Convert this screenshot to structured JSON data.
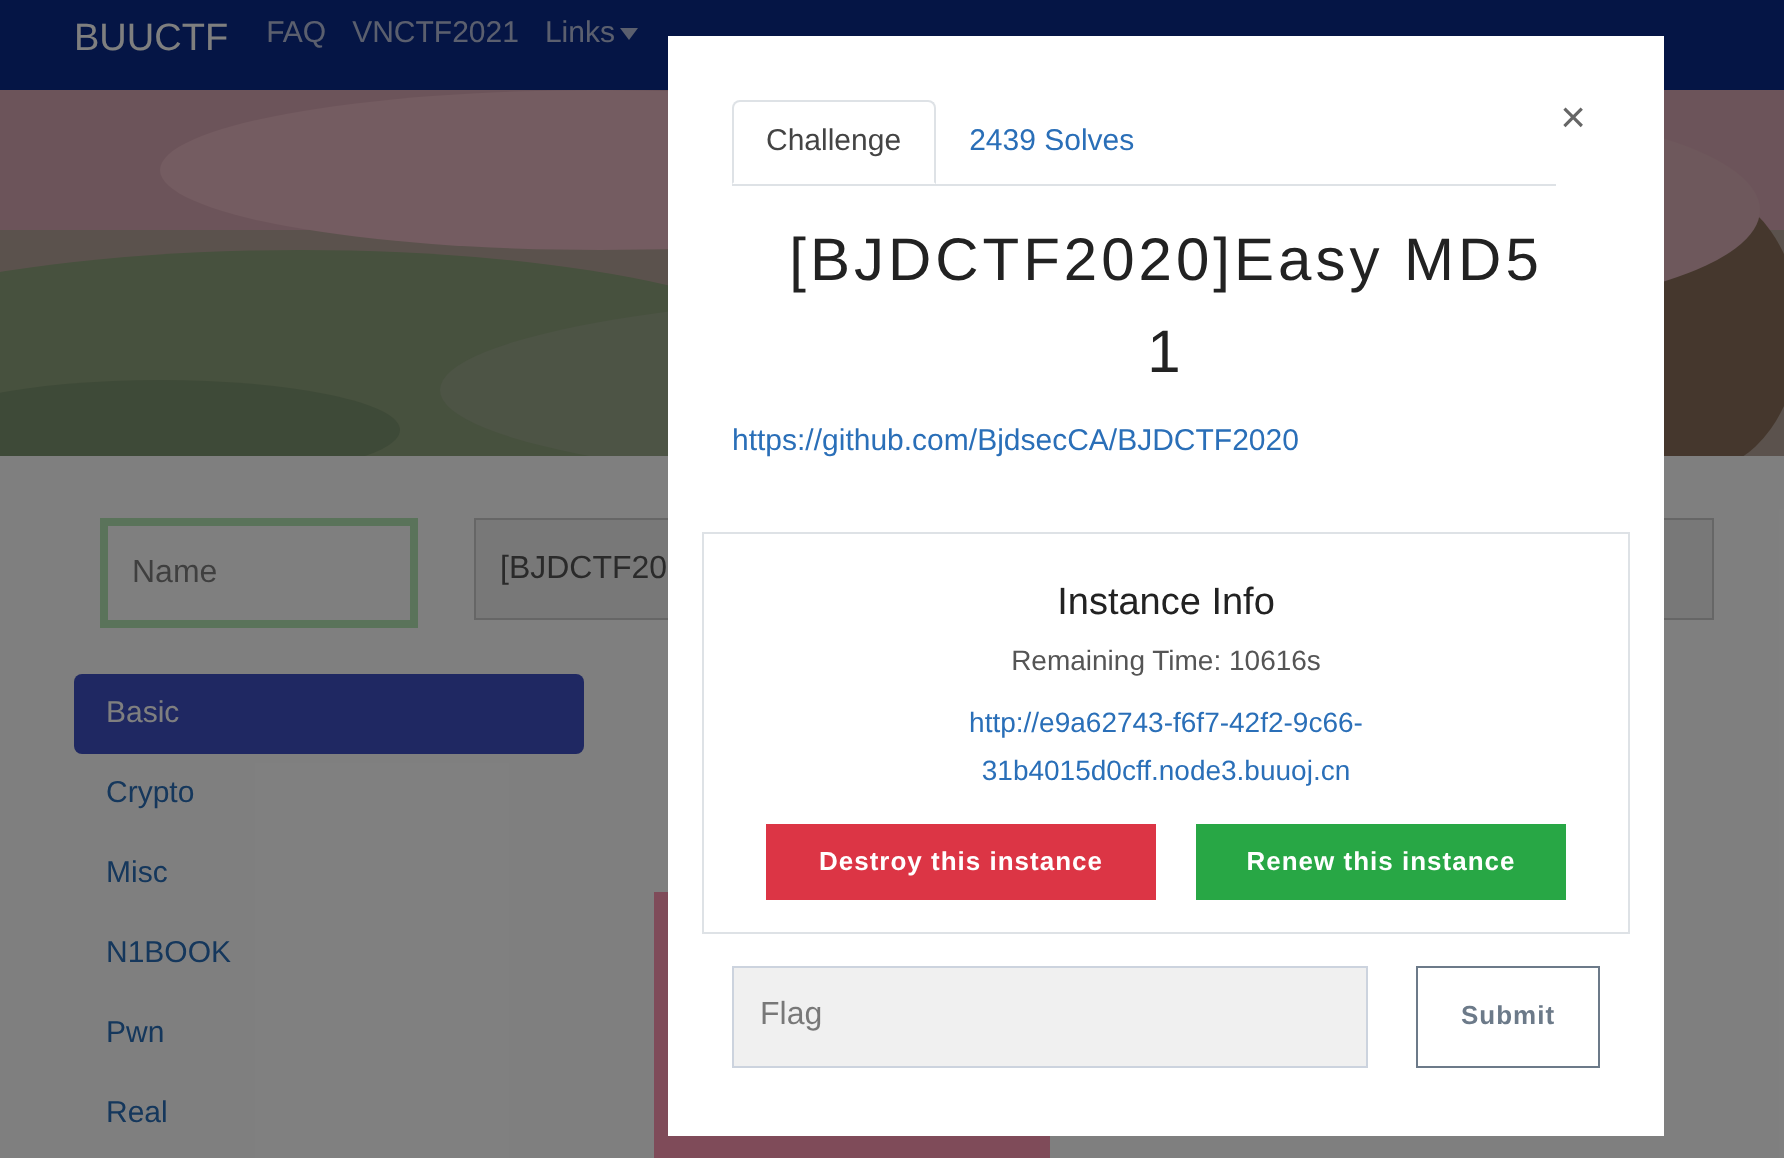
{
  "navbar": {
    "brand": "BUUCTF",
    "items": [
      {
        "label": "FAQ",
        "dropdown": false
      },
      {
        "label": "VNCTF2021",
        "dropdown": false
      },
      {
        "label": "Links",
        "dropdown": true
      }
    ]
  },
  "filters": {
    "name_field": {
      "placeholder": "Name"
    },
    "search_field": {
      "value": "[BJDCTF20"
    }
  },
  "categories": [
    {
      "label": "Basic",
      "selected": true
    },
    {
      "label": "Crypto",
      "selected": false
    },
    {
      "label": "Misc",
      "selected": false
    },
    {
      "label": "N1BOOK",
      "selected": false
    },
    {
      "label": "Pwn",
      "selected": false
    },
    {
      "label": "Real",
      "selected": false
    }
  ],
  "challenge_card": {
    "kind": "card"
  },
  "modal": {
    "tabs": [
      {
        "label": "Challenge",
        "selected": true
      },
      {
        "label": "2439 Solves",
        "selected": false
      }
    ],
    "close": "×",
    "title": "[BJDCTF2020]Easy MD5 1",
    "link": "https://github.com/BjdsecCA/BJDCTF2020",
    "instance": {
      "heading": "Instance Info",
      "remaining": "Remaining Time: 10616s",
      "url": "http://e9a62743-f6f7-42f2-9c66-31b4015d0cff.node3.buuoj.cn",
      "buttons": [
        {
          "label": "Destroy this instance",
          "kind": "danger"
        },
        {
          "label": "Renew this instance",
          "kind": "success"
        }
      ]
    },
    "flag_field": {
      "placeholder": "Flag"
    },
    "submit": "Submit"
  }
}
